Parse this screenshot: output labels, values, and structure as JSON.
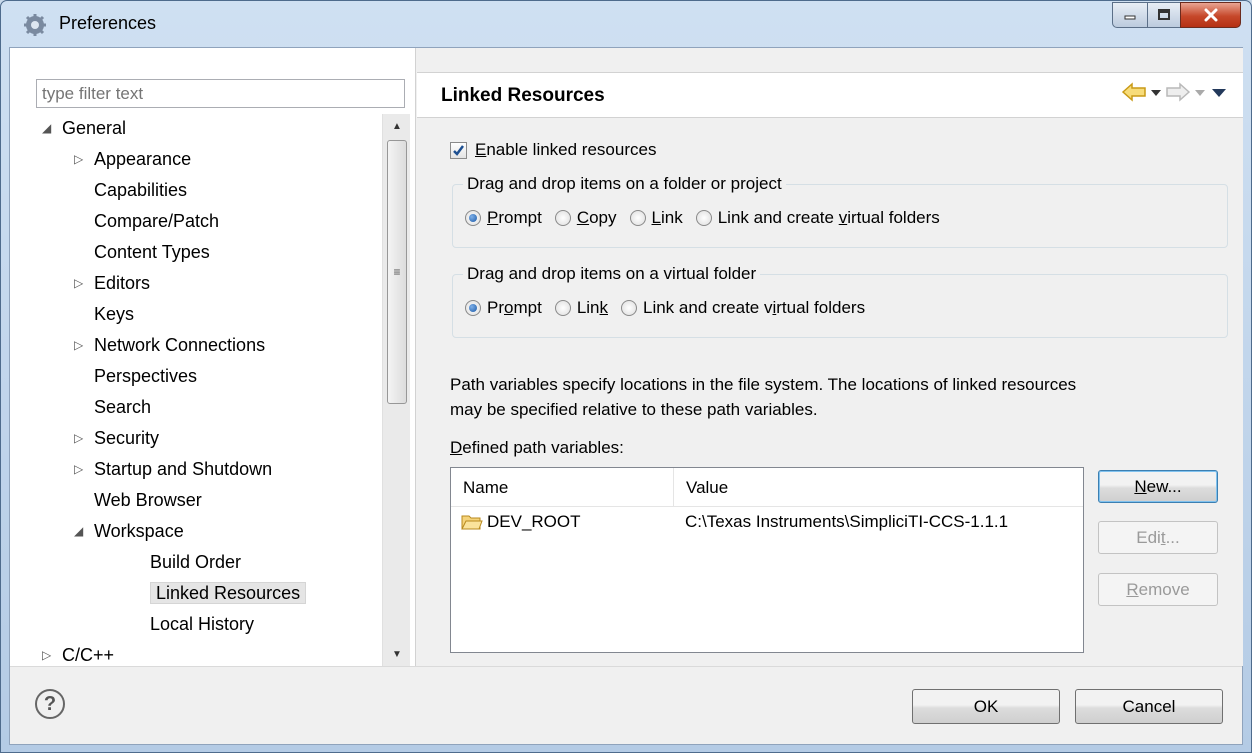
{
  "window": {
    "title": "Preferences"
  },
  "filter": {
    "placeholder": "type filter text"
  },
  "tree": [
    {
      "label": "General",
      "level": 0,
      "twisty": "expanded"
    },
    {
      "label": "Appearance",
      "level": 1,
      "twisty": "collapsed"
    },
    {
      "label": "Capabilities",
      "level": 1,
      "twisty": "none"
    },
    {
      "label": "Compare/Patch",
      "level": 1,
      "twisty": "none"
    },
    {
      "label": "Content Types",
      "level": 1,
      "twisty": "none"
    },
    {
      "label": "Editors",
      "level": 1,
      "twisty": "collapsed"
    },
    {
      "label": "Keys",
      "level": 1,
      "twisty": "none"
    },
    {
      "label": "Network Connections",
      "level": 1,
      "twisty": "collapsed"
    },
    {
      "label": "Perspectives",
      "level": 1,
      "twisty": "none"
    },
    {
      "label": "Search",
      "level": 1,
      "twisty": "none"
    },
    {
      "label": "Security",
      "level": 1,
      "twisty": "collapsed"
    },
    {
      "label": "Startup and Shutdown",
      "level": 1,
      "twisty": "collapsed"
    },
    {
      "label": "Web Browser",
      "level": 1,
      "twisty": "none"
    },
    {
      "label": "Workspace",
      "level": 1,
      "twisty": "expanded"
    },
    {
      "label": "Build Order",
      "level": 2,
      "twisty": "none"
    },
    {
      "label": "Linked Resources",
      "level": 2,
      "twisty": "none",
      "selected": true
    },
    {
      "label": "Local History",
      "level": 2,
      "twisty": "none"
    },
    {
      "label": "C/C++",
      "level": 0,
      "twisty": "collapsed"
    }
  ],
  "page": {
    "title": "Linked Resources",
    "enable_label": {
      "key": "E",
      "rest": "nable linked resources"
    },
    "group1": {
      "title": "Drag and drop items on a folder or project",
      "options": [
        {
          "pre": "",
          "key": "P",
          "post": "rompt",
          "selected": true
        },
        {
          "pre": "",
          "key": "C",
          "post": "opy",
          "selected": false
        },
        {
          "pre": "",
          "key": "L",
          "post": "ink",
          "selected": false
        },
        {
          "pre": "Link and create ",
          "key": "v",
          "post": "irtual folders",
          "selected": false
        }
      ]
    },
    "group2": {
      "title": "Drag and drop items on a virtual folder",
      "options": [
        {
          "pre": "Pr",
          "key": "o",
          "post": "mpt",
          "selected": true
        },
        {
          "pre": "Lin",
          "key": "k",
          "post": "",
          "selected": false
        },
        {
          "pre": "Link and create v",
          "key": "i",
          "post": "rtual folders",
          "selected": false
        }
      ]
    },
    "description_line1": "Path variables specify locations in the file system. The locations of linked resources",
    "description_line2": "may be specified relative to these path variables.",
    "defined_label": {
      "key": "D",
      "rest": "efined path variables:"
    },
    "table": {
      "columns": [
        "Name",
        "Value"
      ],
      "rows": [
        {
          "name": "DEV_ROOT",
          "value": "C:\\Texas Instruments\\SimpliciTI-CCS-1.1.1",
          "icon": "folder-icon"
        }
      ]
    },
    "buttons": {
      "new": {
        "pre": "",
        "key": "N",
        "post": "ew..."
      },
      "edit": {
        "pre": "Edi",
        "key": "t",
        "post": "..."
      },
      "remove": {
        "pre": "",
        "key": "R",
        "post": "emove"
      }
    }
  },
  "footer": {
    "ok": "OK",
    "cancel": "Cancel",
    "help_symbol": "?"
  },
  "colors": {
    "accent": "#1b5aa8",
    "folder": "#e8b64a",
    "nav_arrow": "#e9b830"
  }
}
